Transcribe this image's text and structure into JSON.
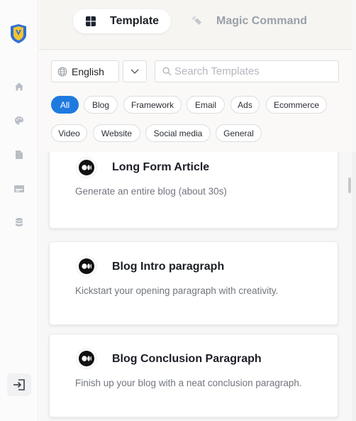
{
  "rail": {
    "icons": [
      "logo-shield-icon",
      "home-icon",
      "palette-icon",
      "document-icon",
      "image-card-icon",
      "database-icon",
      "exit-icon"
    ]
  },
  "tabs": [
    {
      "label": "Template",
      "icon": "grid-icon",
      "active": true
    },
    {
      "label": "Magic Command",
      "icon": "magic-wand-icon",
      "active": false
    }
  ],
  "filters": {
    "language": "English",
    "search_placeholder": "Search Templates",
    "chips": [
      "All",
      "Blog",
      "Framework",
      "Email",
      "Ads",
      "Ecommerce",
      "Video",
      "Website",
      "Social media",
      "General"
    ],
    "active_chip": "All"
  },
  "templates": [
    {
      "title": "Long Form Article",
      "description": "Generate an entire blog (about 30s)",
      "icon": "medium-logo-icon"
    },
    {
      "title": "Blog Intro paragraph",
      "description": "Kickstart your opening paragraph with creativity.",
      "icon": "medium-logo-icon"
    },
    {
      "title": "Blog Conclusion Paragraph",
      "description": "Finish up your blog with a neat conclusion paragraph.",
      "icon": "medium-logo-icon"
    }
  ],
  "colors": {
    "accent": "#1f7ae0",
    "logo_blue": "#2f6fd6",
    "logo_yellow": "#f4c430"
  }
}
